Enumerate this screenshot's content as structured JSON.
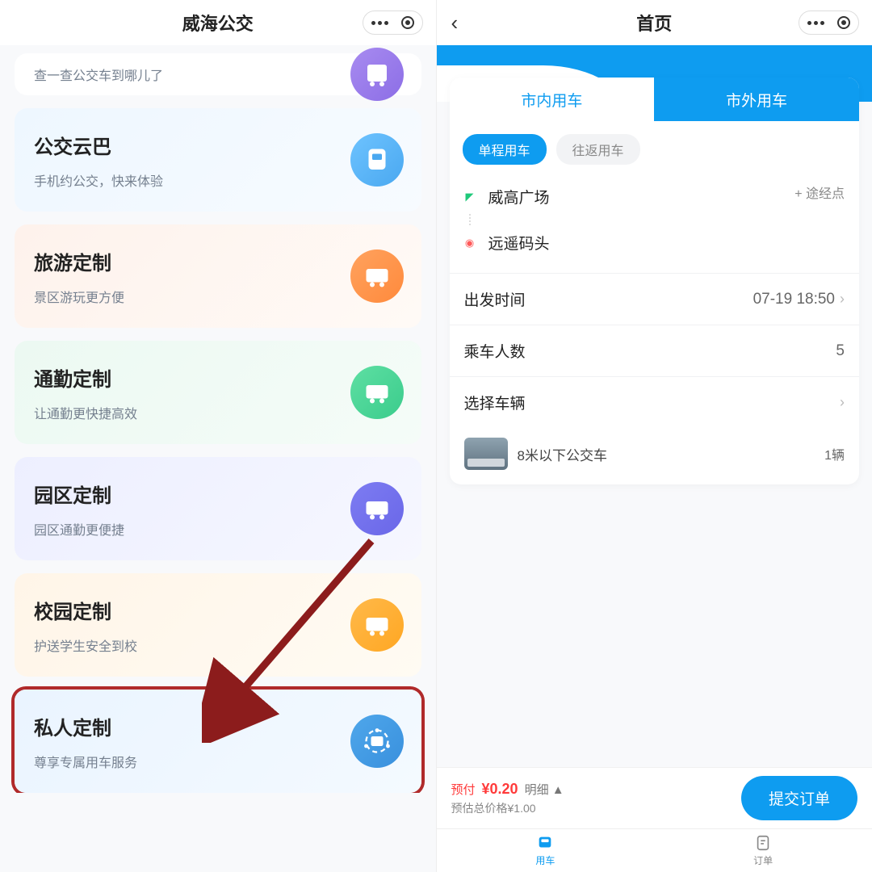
{
  "left": {
    "navbar_title": "威海公交",
    "cards": [
      {
        "title": "",
        "subtitle": "查一查公交车到哪儿了"
      },
      {
        "title": "公交云巴",
        "subtitle": "手机约公交，快来体验"
      },
      {
        "title": "旅游定制",
        "subtitle": "景区游玩更方便"
      },
      {
        "title": "通勤定制",
        "subtitle": "让通勤更快捷高效"
      },
      {
        "title": "园区定制",
        "subtitle": "园区通勤更便捷"
      },
      {
        "title": "校园定制",
        "subtitle": "护送学生安全到校"
      },
      {
        "title": "私人定制",
        "subtitle": "尊享专属用车服务"
      }
    ]
  },
  "right": {
    "navbar_title": "首页",
    "tabs": {
      "city_in": "市内用车",
      "city_out": "市外用车"
    },
    "trip_tabs": {
      "single": "单程用车",
      "round": "往返用车"
    },
    "route": {
      "start": "威高广场",
      "end": "远遥码头",
      "add_via": "+ 途经点"
    },
    "depart": {
      "label": "出发时间",
      "value": "07-19 18:50"
    },
    "pax": {
      "label": "乘车人数",
      "value": "5"
    },
    "select_vehicle_label": "选择车辆",
    "vehicle": {
      "name": "8米以下公交车",
      "count": "1辆"
    },
    "price": {
      "prepay_label": "预付",
      "prepay_amount": "¥0.20",
      "detail": "明细 ▲",
      "total": "预估总价格¥1.00"
    },
    "submit": "提交订单",
    "tabbar": {
      "car": "用车",
      "order": "订单"
    }
  }
}
